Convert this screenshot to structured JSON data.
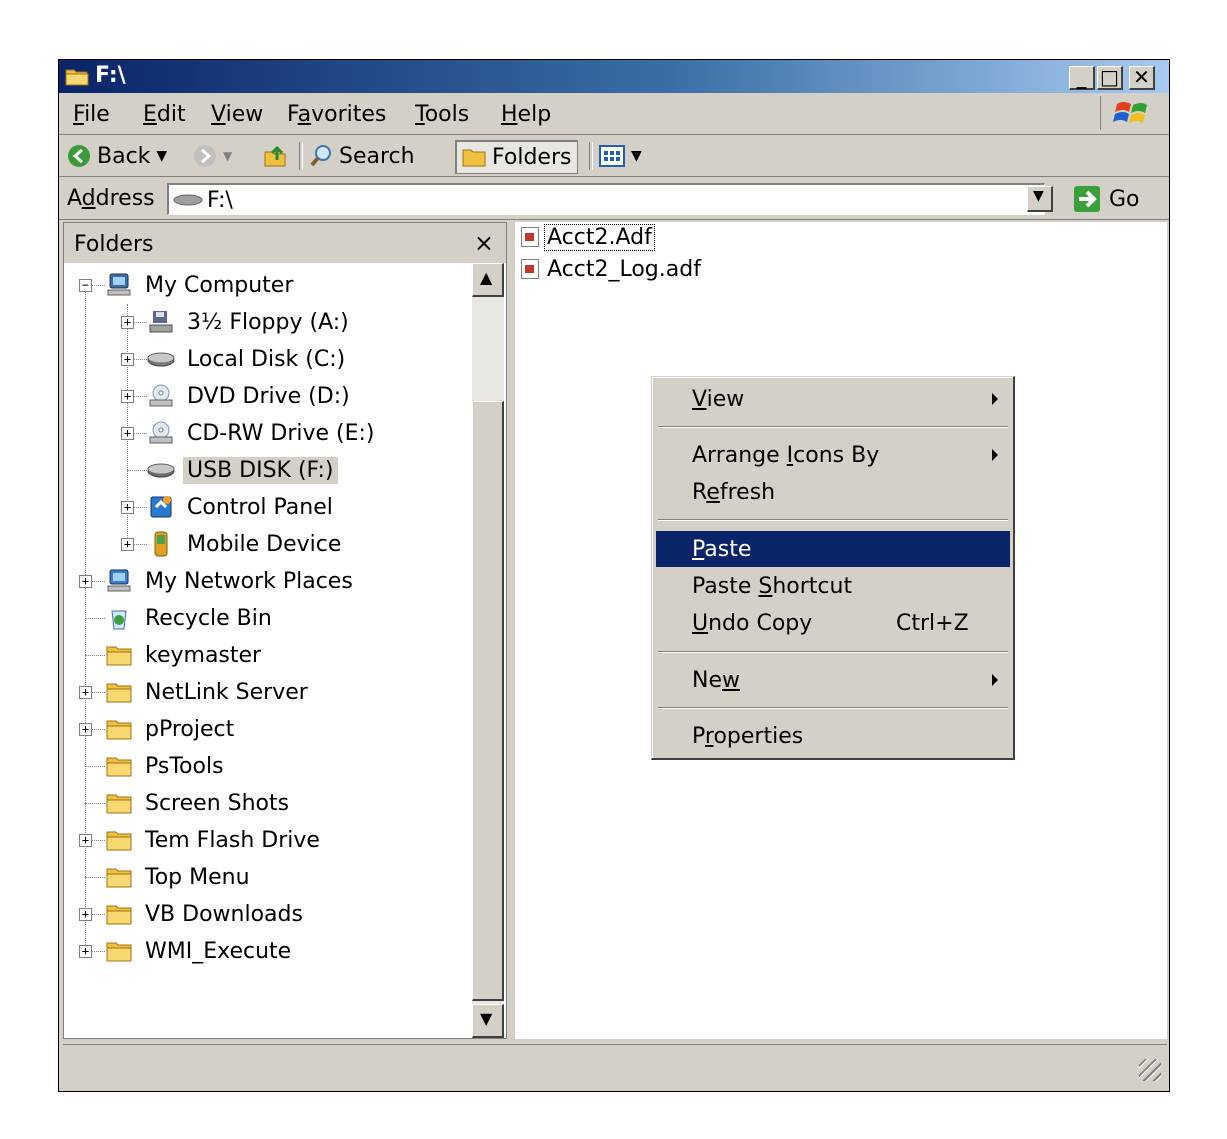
{
  "window": {
    "title": "F:\\"
  },
  "menubar": [
    {
      "pre": "",
      "u": "F",
      "post": "ile"
    },
    {
      "pre": "",
      "u": "E",
      "post": "dit"
    },
    {
      "pre": "",
      "u": "V",
      "post": "iew"
    },
    {
      "pre": "F",
      "u": "a",
      "post": "vorites"
    },
    {
      "pre": "",
      "u": "T",
      "post": "ools"
    },
    {
      "pre": "",
      "u": "H",
      "post": "elp"
    }
  ],
  "toolbar": {
    "back": "Back",
    "search": "Search",
    "folders": "Folders"
  },
  "address": {
    "label_pre": "A",
    "label_u": "d",
    "label_post": "dress",
    "value": "F:\\",
    "go": "Go"
  },
  "folders_pane": {
    "title": "Folders",
    "close": "×",
    "items": [
      {
        "label": "My Computer",
        "icon": "computer-icon",
        "color": "#3a6ea5"
      },
      {
        "label": "3½ Floppy (A:)",
        "icon": "floppy-icon",
        "color": "#5b6a8a"
      },
      {
        "label": "Local Disk (C:)",
        "icon": "hard-disk-icon",
        "color": "#808080"
      },
      {
        "label": "DVD Drive (D:)",
        "icon": "dvd-drive-icon",
        "color": "#8a9ab0"
      },
      {
        "label": "CD-RW Drive (E:)",
        "icon": "cd-drive-icon",
        "color": "#8a9ab0"
      },
      {
        "label": "USB DISK (F:)",
        "icon": "usb-disk-icon",
        "color": "#707070"
      },
      {
        "label": "Control Panel",
        "icon": "control-panel-icon",
        "color": "#2a7ad0"
      },
      {
        "label": "Mobile Device",
        "icon": "mobile-device-icon",
        "color": "#e0a020"
      },
      {
        "label": "My Network Places",
        "icon": "network-icon",
        "color": "#3a7ed0"
      },
      {
        "label": "Recycle Bin",
        "icon": "recycle-bin-icon",
        "color": "#40a040"
      },
      {
        "label": "keymaster",
        "icon": "folder-icon",
        "color": "#f0c040"
      },
      {
        "label": "NetLink Server",
        "icon": "folder-icon",
        "color": "#f0c040"
      },
      {
        "label": "pProject",
        "icon": "folder-icon",
        "color": "#f0c040"
      },
      {
        "label": "PsTools",
        "icon": "folder-icon",
        "color": "#f0c040"
      },
      {
        "label": "Screen Shots",
        "icon": "folder-icon",
        "color": "#f0c040"
      },
      {
        "label": "Tem Flash Drive",
        "icon": "folder-icon",
        "color": "#f0c040"
      },
      {
        "label": "Top Menu",
        "icon": "folder-icon",
        "color": "#f0c040"
      },
      {
        "label": "VB Downloads",
        "icon": "folder-icon",
        "color": "#f0c040"
      },
      {
        "label": "WMI_Execute",
        "icon": "folder-icon",
        "color": "#f0c040"
      }
    ]
  },
  "files": [
    {
      "name": "Acct2.Adf"
    },
    {
      "name": "Acct2_Log.adf"
    }
  ],
  "context_menu": [
    {
      "pre": "",
      "u": "V",
      "post": "iew",
      "submenu": true
    },
    {
      "pre": "Arrange ",
      "u": "I",
      "post": "cons By",
      "submenu": true
    },
    {
      "pre": "R",
      "u": "e",
      "post": "fresh"
    },
    {
      "pre": "",
      "u": "P",
      "post": "aste",
      "highlighted": true
    },
    {
      "pre": "Paste ",
      "u": "S",
      "post": "hortcut"
    },
    {
      "pre": "",
      "u": "U",
      "post": "ndo Copy",
      "shortcut": "Ctrl+Z"
    },
    {
      "pre": "Ne",
      "u": "w",
      "post": "",
      "submenu": true
    },
    {
      "pre": "P",
      "u": "r",
      "post": "operties"
    }
  ],
  "colors": {
    "title_start": "#0a246a",
    "title_end": "#a6caf0",
    "highlight": "#0a246a",
    "face": "#d4d0c8"
  }
}
